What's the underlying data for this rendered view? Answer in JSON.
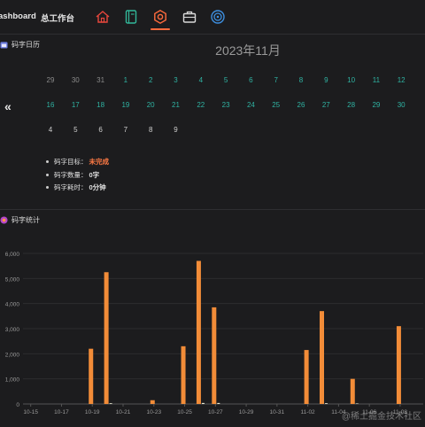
{
  "header": {
    "brand": "ashboard",
    "workspace": "总工作台",
    "nav_icons": [
      "home-icon",
      "notebook-icon",
      "settings-icon",
      "briefcase-icon",
      "target-icon"
    ],
    "active_icon": "settings-icon",
    "colors": {
      "home": "#e8473c",
      "notebook": "#32b89a",
      "settings": "#ff6b3d",
      "briefcase": "#d9d9d9",
      "target": "#3d8fe0"
    }
  },
  "calendar": {
    "title": "码字日历",
    "month": "2023年11月",
    "prev_label": "«",
    "rows": [
      [
        {
          "d": "29",
          "s": "g"
        },
        {
          "d": "30",
          "s": "g"
        },
        {
          "d": "31",
          "s": "g"
        },
        {
          "d": "1",
          "s": "t"
        },
        {
          "d": "2",
          "s": "t"
        },
        {
          "d": "3",
          "s": "t"
        },
        {
          "d": "4",
          "s": "t"
        },
        {
          "d": "5",
          "s": "t"
        },
        {
          "d": "6",
          "s": "t"
        },
        {
          "d": "7",
          "s": "t"
        },
        {
          "d": "8",
          "s": "t"
        },
        {
          "d": "9",
          "s": "t"
        },
        {
          "d": "10",
          "s": "t"
        },
        {
          "d": "11",
          "s": "t"
        },
        {
          "d": "12",
          "s": "t"
        }
      ],
      [
        {
          "d": "16",
          "s": "t"
        },
        {
          "d": "17",
          "s": "t"
        },
        {
          "d": "18",
          "s": "t"
        },
        {
          "d": "19",
          "s": "t"
        },
        {
          "d": "20",
          "s": "t"
        },
        {
          "d": "21",
          "s": "t"
        },
        {
          "d": "22",
          "s": "t"
        },
        {
          "d": "23",
          "s": "t"
        },
        {
          "d": "24",
          "s": "t"
        },
        {
          "d": "25",
          "s": "t"
        },
        {
          "d": "26",
          "s": "t"
        },
        {
          "d": "27",
          "s": "t"
        },
        {
          "d": "28",
          "s": "t"
        },
        {
          "d": "29",
          "s": "t"
        },
        {
          "d": "30",
          "s": "t"
        }
      ],
      [
        {
          "d": "4",
          "s": "w"
        },
        {
          "d": "5",
          "s": "w"
        },
        {
          "d": "6",
          "s": "w"
        },
        {
          "d": "7",
          "s": "w"
        },
        {
          "d": "8",
          "s": "w"
        },
        {
          "d": "9",
          "s": "w"
        }
      ]
    ],
    "info": [
      {
        "label": "码字目标：",
        "value": "未完成",
        "accent": true
      },
      {
        "label": "码字数量：",
        "value": "0字",
        "accent": false
      },
      {
        "label": "码字耗时：",
        "value": "0分钟",
        "accent": false
      }
    ]
  },
  "stats": {
    "title": "码字统计"
  },
  "chart_data": {
    "type": "bar",
    "categories": [
      "10-15",
      "10-16",
      "10-17",
      "10-18",
      "10-19",
      "10-20",
      "10-21",
      "10-22",
      "10-23",
      "10-24",
      "10-25",
      "10-26",
      "10-27",
      "10-28",
      "10-29",
      "10-30",
      "10-31",
      "11-01",
      "11-02",
      "11-03",
      "11-04",
      "11-05",
      "11-06",
      "11-07",
      "11-08",
      "11-09"
    ],
    "tick_labels": [
      "10-15",
      "10-17",
      "10-19",
      "10-21",
      "10-23",
      "10-25",
      "10-27",
      "10-29",
      "10-31",
      "11-02",
      "11-04",
      "11-06",
      "11-08"
    ],
    "series": [
      {
        "values": [
          0,
          0,
          0,
          0,
          2200,
          5250,
          0,
          0,
          150,
          0,
          2300,
          5700,
          3850,
          0,
          0,
          0,
          0,
          0,
          2150,
          3700,
          0,
          1000,
          0,
          0,
          3100,
          0
        ],
        "color": "#f28c38"
      },
      {
        "values": [
          0,
          0,
          0,
          0,
          0,
          30,
          0,
          0,
          0,
          0,
          0,
          40,
          40,
          0,
          0,
          0,
          0,
          0,
          0,
          30,
          0,
          20,
          0,
          0,
          0,
          0
        ],
        "color": "#e8e8d0"
      }
    ],
    "yticks": [
      "0",
      "1,000",
      "2,000",
      "3,000",
      "4,000",
      "5,000",
      "6,000"
    ],
    "ylim": [
      0,
      6000
    ],
    "xlabel": "",
    "ylabel": "",
    "grid": true
  },
  "watermark": "@稀土掘金技术社区"
}
